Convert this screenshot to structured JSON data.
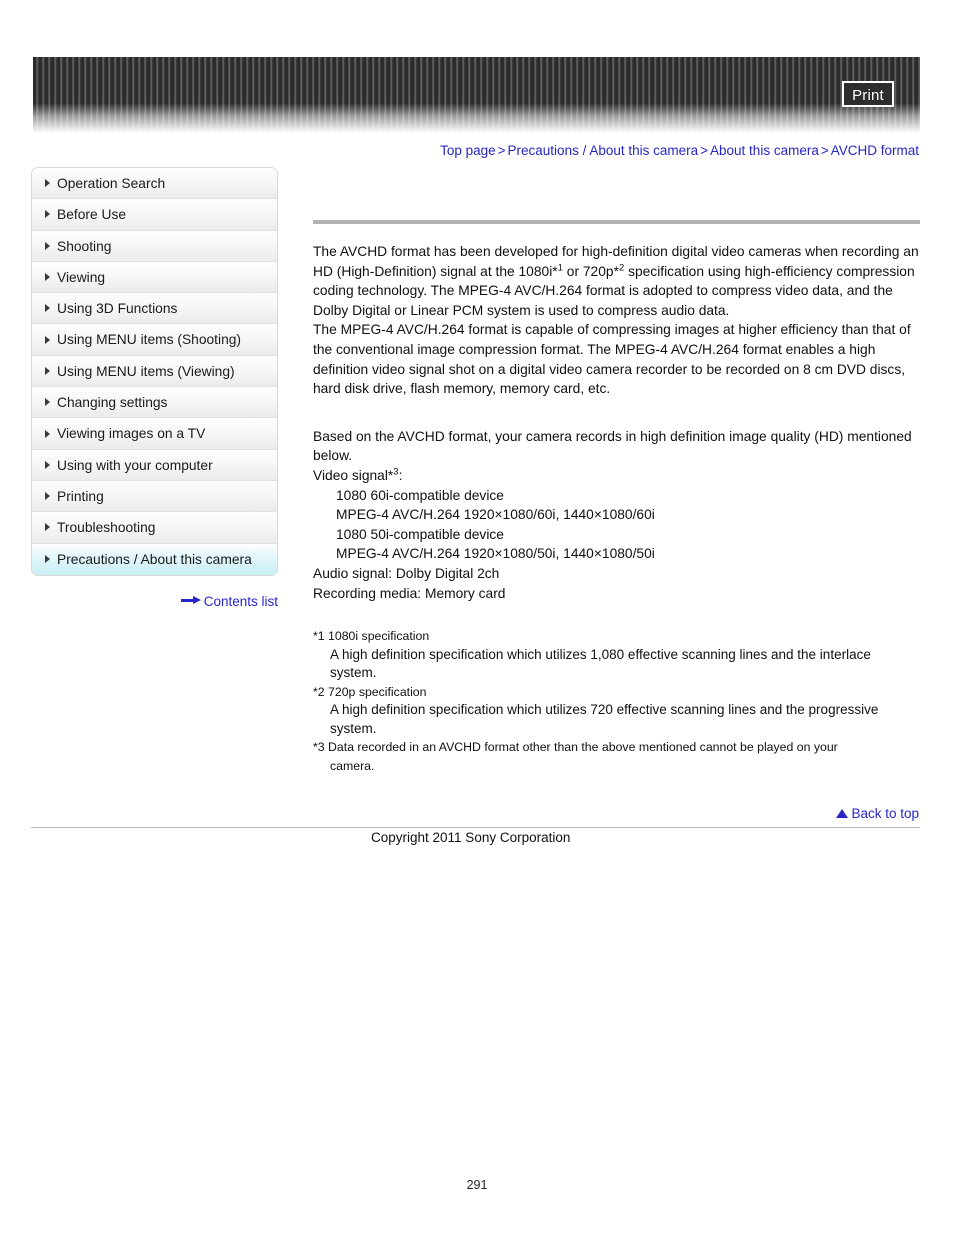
{
  "header": {
    "print_label": "Print"
  },
  "breadcrumb": {
    "separator": ">",
    "items": [
      {
        "label": "Top page"
      },
      {
        "label": "Precautions / About this camera"
      },
      {
        "label": "About this camera"
      },
      {
        "label": "AVCHD format"
      }
    ]
  },
  "sidebar": {
    "items": [
      {
        "label": "Operation Search",
        "selected": false
      },
      {
        "label": "Before Use",
        "selected": false
      },
      {
        "label": "Shooting",
        "selected": false
      },
      {
        "label": "Viewing",
        "selected": false
      },
      {
        "label": "Using 3D Functions",
        "selected": false
      },
      {
        "label": "Using MENU items (Shooting)",
        "selected": false
      },
      {
        "label": "Using MENU items (Viewing)",
        "selected": false
      },
      {
        "label": "Changing settings",
        "selected": false
      },
      {
        "label": "Viewing images on a TV",
        "selected": false
      },
      {
        "label": "Using with your computer",
        "selected": false
      },
      {
        "label": "Printing",
        "selected": false
      },
      {
        "label": "Troubleshooting",
        "selected": false
      },
      {
        "label": "Precautions / About this camera",
        "selected": true
      }
    ],
    "contents_list_label": "Contents list"
  },
  "content": {
    "paragraph1_part1": "The AVCHD format has been developed for high-definition digital video cameras when recording an HD (High-Definition) signal at the 1080i*",
    "paragraph1_sup1": "1",
    "paragraph1_part2": " or 720p*",
    "paragraph1_sup2": "2",
    "paragraph1_part3": " specification using high-efficiency compression coding technology. The MPEG-4 AVC/H.264 format is adopted to compress video data, and the Dolby Digital or Linear PCM system is used to compress audio data.",
    "paragraph2": "The MPEG-4 AVC/H.264 format is capable of compressing images at higher efficiency than that of the conventional image compression format. The MPEG-4 AVC/H.264 format enables a high definition video signal shot on a digital video camera recorder to be recorded on 8 cm DVD discs, hard disk drive, flash memory, memory card, etc.",
    "paragraph3": "Based on the AVCHD format, your camera records in high definition image quality (HD) mentioned below.",
    "video_signal_label": "Video signal*",
    "video_signal_sup": "3",
    "video_signal_colon": ":",
    "spec_lines": [
      "1080 60i-compatible device",
      "MPEG-4 AVC/H.264 1920×1080/60i, 1440×1080/60i",
      "1080 50i-compatible device",
      "MPEG-4 AVC/H.264 1920×1080/50i, 1440×1080/50i"
    ],
    "audio_signal": "Audio signal: Dolby Digital 2ch",
    "recording_media": "Recording media: Memory card",
    "footnotes": [
      {
        "label": "*1 1080i specification",
        "body": "A high definition specification which utilizes 1,080 effective scanning lines and the interlace system."
      },
      {
        "label": "*2 720p specification",
        "body": "A high definition specification which utilizes 720 effective scanning lines and the progressive system."
      },
      {
        "label": "*3 Data recorded in an AVCHD format other than the above mentioned cannot be played on your",
        "body": "camera."
      }
    ]
  },
  "footer": {
    "back_to_top_label": "Back to top",
    "copyright": "Copyright 2011 Sony Corporation",
    "page_number": "291"
  },
  "colors": {
    "link": "#2727c8",
    "rule": "#b2b2b2",
    "selected_sidebar": "#c8eef5"
  }
}
